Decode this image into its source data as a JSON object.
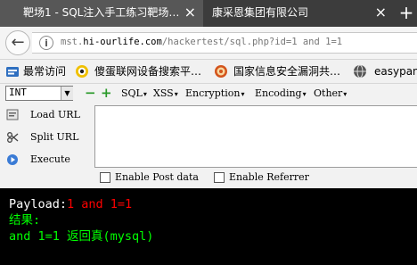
{
  "tabs": [
    {
      "title": "靶场1 - SQL注入手工练习靶场…",
      "close": "×"
    },
    {
      "title": "康采恩集团有限公司",
      "close": "×"
    }
  ],
  "new_tab": "+",
  "address_bar": {
    "url_prefix": "mst.",
    "url_domain": "hi-ourlife.com",
    "url_path": "/hackertest/sql.php?id=1 and 1=1",
    "info_icon": "i"
  },
  "bookmarks": [
    {
      "label": "最常访问",
      "icon": "bookmark-folder-icon",
      "color": "#2f6fc0"
    },
    {
      "label": "傻蛋联网设备搜索平…",
      "icon": "shodan-logo-icon",
      "color": "#e0a400"
    },
    {
      "label": "国家信息安全漏洞共…",
      "icon": "cnnvd-logo-icon",
      "color": "#d3541c"
    },
    {
      "label": "easypane",
      "icon": "globe-icon",
      "color": "#666666"
    }
  ],
  "hackbar": {
    "select_value": "INT",
    "menus": [
      "SQL",
      "XSS",
      "Encryption",
      "Encoding",
      "Other"
    ],
    "actions": [
      {
        "label": "Load URL",
        "icon": "load-url-icon"
      },
      {
        "label": "Split URL",
        "icon": "split-url-icon"
      },
      {
        "label": "Execute",
        "icon": "execute-icon"
      }
    ],
    "textarea_value": "",
    "options": [
      "Enable Post data",
      "Enable Referrer"
    ]
  },
  "output": {
    "payload_label": "Payload:",
    "payload_value": "1 and 1=1",
    "result_label": "结果:",
    "result_value": "and 1=1 返回真(mysql)",
    "colors": {
      "label": "#ffffff",
      "payload": "#ff0000",
      "result": "#00ff00"
    }
  }
}
